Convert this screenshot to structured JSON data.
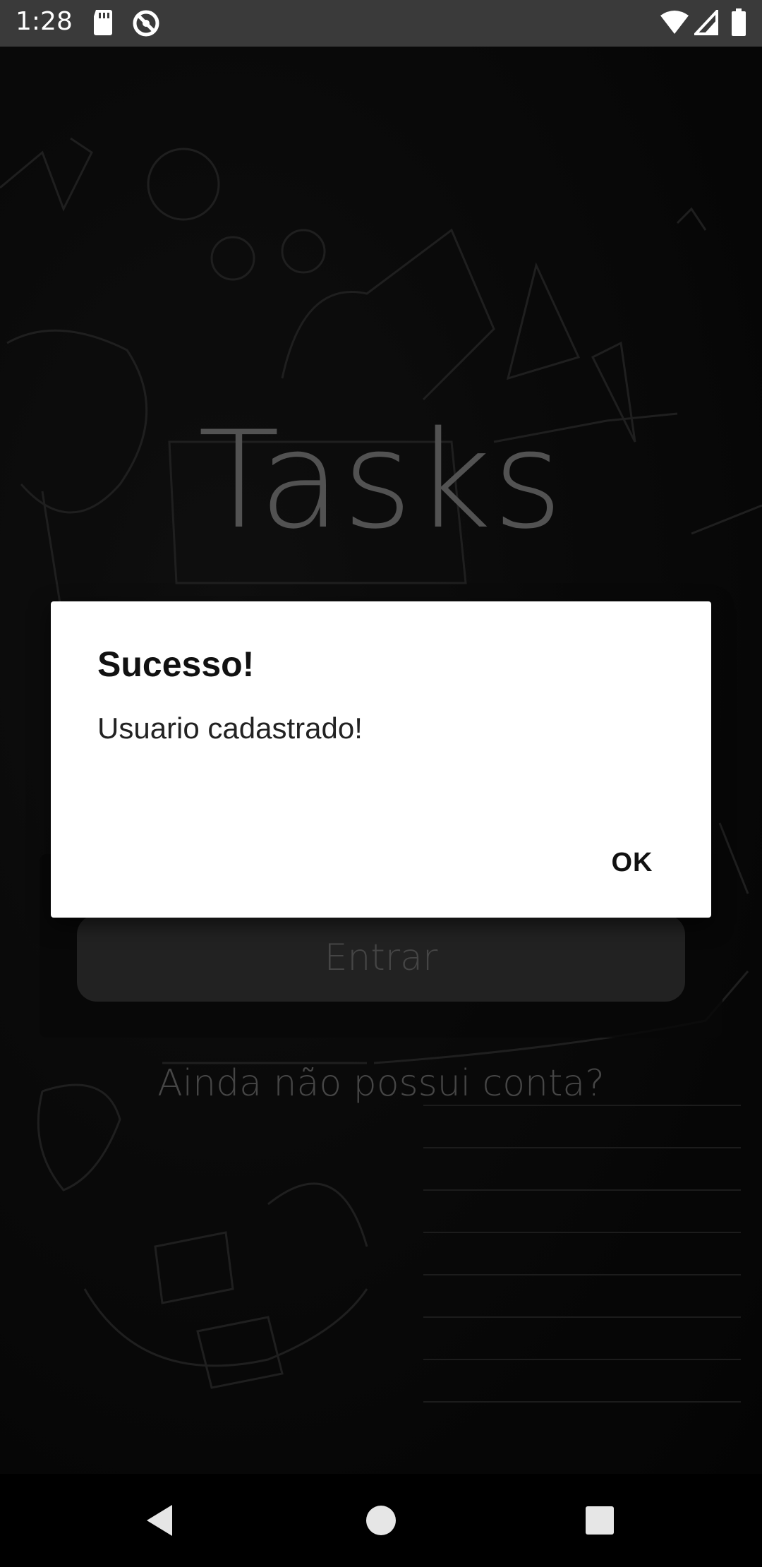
{
  "status_bar": {
    "time": "1:28",
    "icons": [
      "sd-card-icon",
      "data-saver-icon",
      "wifi-icon",
      "signal-icon",
      "battery-icon"
    ]
  },
  "app": {
    "title": "Tasks",
    "enter_button_label": "Entrar",
    "signup_link": "Ainda não possui conta?"
  },
  "dialog": {
    "title": "Sucesso!",
    "message": "Usuario cadastrado!",
    "ok_label": "OK"
  },
  "nav_bar": {
    "buttons": [
      "back-icon",
      "home-icon",
      "recents-icon"
    ]
  },
  "colors": {
    "status_bar_bg": "#3a3a3a",
    "dialog_bg": "#ffffff",
    "title_gray": "#6e6e6e"
  }
}
